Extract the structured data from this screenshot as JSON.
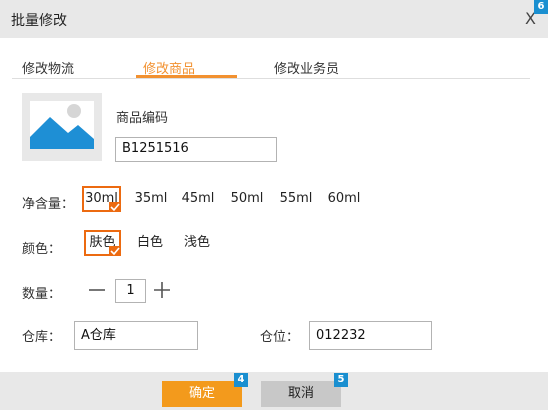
{
  "dialog": {
    "title": "批量修改",
    "close_label": "X",
    "close_badge": "6"
  },
  "tabs": [
    {
      "label": "修改物流",
      "active": false
    },
    {
      "label": "修改商品",
      "active": true
    },
    {
      "label": "修改业务员",
      "active": false
    }
  ],
  "product": {
    "code_label": "商品编码",
    "code_value": "B1251516",
    "image_icon": "image-placeholder-icon"
  },
  "volume": {
    "label": "净含量：",
    "options": [
      "30ml",
      "35ml",
      "45ml",
      "50ml",
      "55ml",
      "60ml"
    ],
    "selected": "30ml"
  },
  "color": {
    "label": "颜色：",
    "options": [
      "肤色",
      "白色",
      "浅色"
    ],
    "selected": "肤色"
  },
  "quantity": {
    "label": "数量：",
    "value": "1"
  },
  "warehouse": {
    "label": "仓库：",
    "value": "A仓库"
  },
  "location": {
    "label": "仓位：",
    "value": "012232"
  },
  "footer": {
    "ok_label": "确定",
    "ok_badge": "4",
    "cancel_label": "取消",
    "cancel_badge": "5"
  },
  "colors": {
    "accent": "#f29130",
    "selected_border": "#ec6a10",
    "badge": "#1a8fd0",
    "header_bg": "#e8e8e8"
  }
}
